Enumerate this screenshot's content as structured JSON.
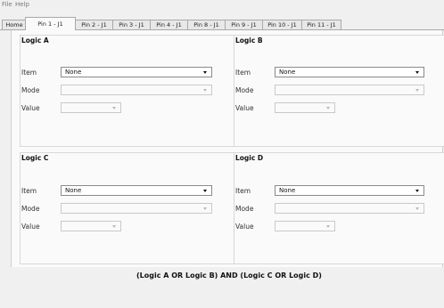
{
  "menu": {
    "file": "File",
    "help": "Help"
  },
  "tabs": [
    "Home",
    "Pin 1 - J1",
    "Pin 2 - J1",
    "Pin 3 - J1",
    "Pin 4 - J1",
    "Pin 8 - J1",
    "Pin 9 - J1",
    "Pin 10 - J1",
    "Pin 11 - J1"
  ],
  "active_tab": "Pin 1 - J1",
  "labels": {
    "item": "Item",
    "mode": "Mode",
    "value": "Value"
  },
  "panels": [
    {
      "title": "Logic A",
      "item_value": "None",
      "mode_value": "",
      "value_value": ""
    },
    {
      "title": "Logic B",
      "item_value": "None",
      "mode_value": "",
      "value_value": ""
    },
    {
      "title": "Logic C",
      "item_value": "None",
      "mode_value": "",
      "value_value": ""
    },
    {
      "title": "Logic D",
      "item_value": "None",
      "mode_value": "",
      "value_value": ""
    }
  ],
  "expression": "(Logic A OR Logic B) AND (Logic C OR Logic D)"
}
